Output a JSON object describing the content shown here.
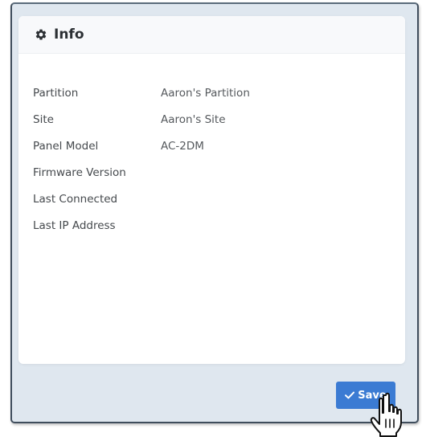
{
  "card": {
    "title": "Info",
    "title_icon": "gear-icon"
  },
  "info_rows": [
    {
      "label": "Partition",
      "value": "Aaron's Partition"
    },
    {
      "label": "Site",
      "value": "Aaron's Site"
    },
    {
      "label": "Panel Model",
      "value": "AC-2DM"
    },
    {
      "label": "Firmware Version",
      "value": ""
    },
    {
      "label": "Last Connected",
      "value": ""
    },
    {
      "label": "Last IP Address",
      "value": ""
    }
  ],
  "footer": {
    "save_label": "Save",
    "save_icon": "checkmark-icon"
  },
  "colors": {
    "accent": "#3b7bd3",
    "panel_bg": "#dfe7ef",
    "card_bg": "#ffffff"
  },
  "cursor": "hand-pointer-icon"
}
